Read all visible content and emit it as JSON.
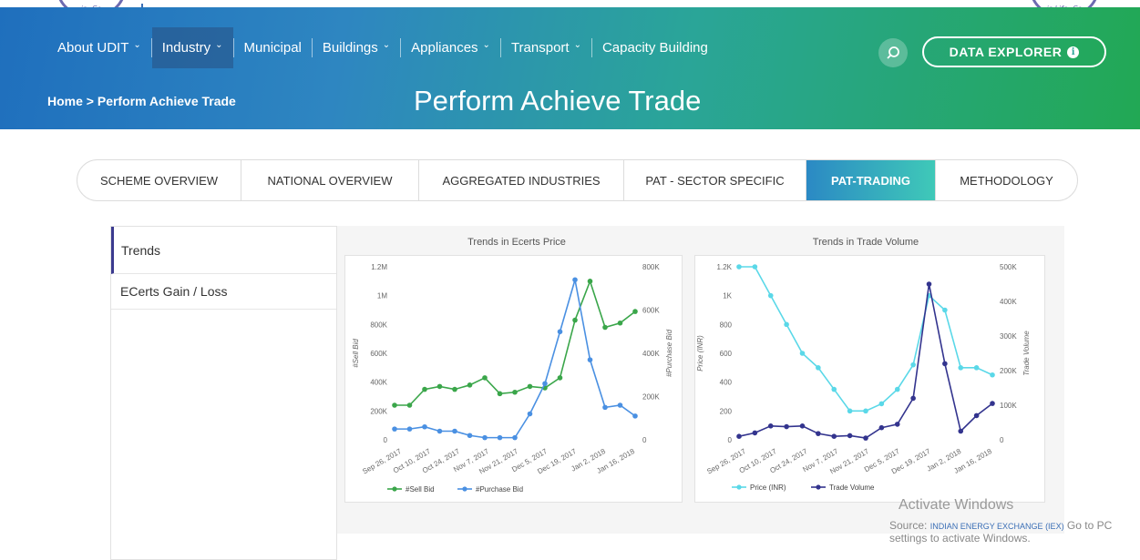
{
  "header": {
    "nav": [
      {
        "label": "About UDIT",
        "dropdown": true,
        "active": false
      },
      {
        "label": "Industry",
        "dropdown": true,
        "active": true
      },
      {
        "label": "Municipal",
        "dropdown": false,
        "active": false
      },
      {
        "label": "Buildings",
        "dropdown": true,
        "active": false
      },
      {
        "label": "Appliances",
        "dropdown": true,
        "active": false
      },
      {
        "label": "Transport",
        "dropdown": true,
        "active": false
      },
      {
        "label": "Capacity Building",
        "dropdown": false,
        "active": false
      }
    ],
    "search_icon": "search-icon",
    "explorer_label": "DATA EXPLORER",
    "breadcrumb": "Home > Perform Achieve Trade",
    "title": "Perform Achieve Trade"
  },
  "tabs": [
    {
      "label": "SCHEME OVERVIEW",
      "active": false
    },
    {
      "label": "NATIONAL OVERVIEW",
      "active": false
    },
    {
      "label": "AGGREGATED INDUSTRIES",
      "active": false
    },
    {
      "label": "PAT - SECTOR SPECIFIC",
      "active": false
    },
    {
      "label": "PAT-TRADING",
      "active": true
    },
    {
      "label": "METHODOLOGY",
      "active": false
    }
  ],
  "sidebar": [
    {
      "label": "Trends",
      "active": true
    },
    {
      "label": "ECerts Gain / Loss",
      "active": false
    }
  ],
  "colors": {
    "sell_bid": "#3aa64a",
    "purchase_bid": "#4a90e2",
    "price": "#5ad8e8",
    "trade_volume": "#33348e"
  },
  "chart_data": [
    {
      "type": "line",
      "title": "Trends in Ecerts Price",
      "x": [
        "Sep 26, 2017",
        "Oct 10, 2017",
        "Oct 24, 2017",
        "Nov 7, 2017",
        "Nov 21, 2017",
        "Dec 5, 2017",
        "Dec 19, 2017",
        "Jan 2, 2018",
        "Jan 16, 2018"
      ],
      "x_points": 19,
      "series": [
        {
          "name": "#Sell Bid",
          "axis": "left",
          "values": [
            240000,
            240000,
            350000,
            370000,
            350000,
            380000,
            430000,
            320000,
            330000,
            370000,
            360000,
            430000,
            830000,
            1100000,
            780000,
            810000,
            890000
          ]
        },
        {
          "name": "#Purchase Bid",
          "axis": "right",
          "values": [
            50000,
            50000,
            60000,
            40000,
            40000,
            20000,
            10000,
            10000,
            10000,
            120000,
            260000,
            500000,
            740000,
            370000,
            150000,
            160000,
            110000
          ]
        }
      ],
      "ylabel_left": "#Sell Bid",
      "ylabel_right": "#Purchase Bid",
      "yticks_left": [
        "0",
        "200K",
        "400K",
        "600K",
        "800K",
        "1M",
        "1.2M"
      ],
      "yticks_right": [
        "0",
        "200K",
        "400K",
        "600K",
        "800K"
      ],
      "ylim_left": [
        0,
        1200000
      ],
      "ylim_right": [
        0,
        800000
      ],
      "legend": "bottom"
    },
    {
      "type": "line",
      "title": "Trends in Trade Volume",
      "x": [
        "Sep 26, 2017",
        "Oct 10, 2017",
        "Oct 24, 2017",
        "Nov 7, 2017",
        "Nov 21, 2017",
        "Dec 5, 2017",
        "Dec 19, 2017",
        "Jan 2, 2018",
        "Jan 16, 2018"
      ],
      "series": [
        {
          "name": "Price (INR)",
          "axis": "left",
          "values": [
            1200,
            1200,
            1000,
            800,
            600,
            500,
            350,
            200,
            200,
            250,
            350,
            520,
            1000,
            900,
            500,
            500,
            450
          ]
        },
        {
          "name": "Trade Volume",
          "axis": "right",
          "values": [
            10000,
            20000,
            40000,
            38000,
            40000,
            18000,
            10000,
            12000,
            5000,
            35000,
            45000,
            120000,
            450000,
            220000,
            25000,
            70000,
            105000
          ]
        }
      ],
      "ylabel_left": "Price (INR)",
      "ylabel_right": "Trade Volume",
      "yticks_left": [
        "0",
        "200",
        "400",
        "600",
        "800",
        "1K",
        "1.2K"
      ],
      "yticks_right": [
        "0",
        "100K",
        "200K",
        "300K",
        "400K",
        "500K"
      ],
      "ylim_left": [
        0,
        1200
      ],
      "ylim_right": [
        0,
        500000
      ],
      "legend": "bottom"
    }
  ],
  "source": {
    "prefix": "Source:",
    "link": "INDIAN ENERGY EXCHANGE (IEX)"
  },
  "watermark": {
    "title": "Activate Windows",
    "subtitle": "Go to PC settings to activate Windows."
  }
}
